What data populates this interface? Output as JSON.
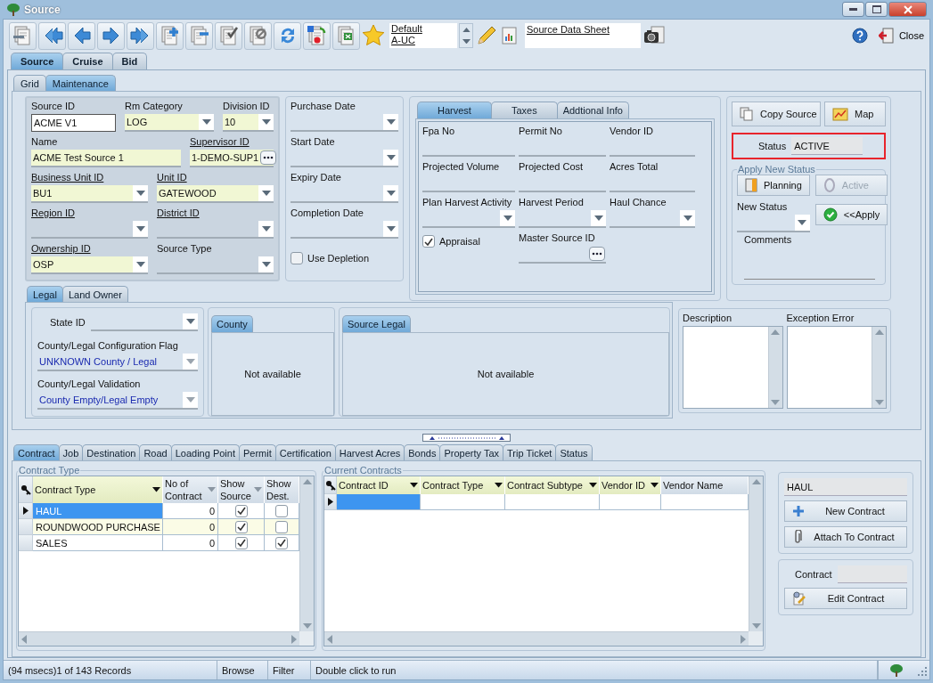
{
  "window": {
    "title": "Source",
    "close_label": "Close"
  },
  "toolbar": {
    "layouts": [
      "Default",
      "A-UC"
    ],
    "report": "Source Data Sheet"
  },
  "main_tabs": [
    {
      "label": "Source",
      "selected": true
    },
    {
      "label": "Cruise",
      "selected": false
    },
    {
      "label": "Bid",
      "selected": false
    }
  ],
  "sub_tabs": [
    {
      "label": "Grid",
      "selected": false
    },
    {
      "label": "Maintenance",
      "selected": true
    }
  ],
  "source": {
    "rows": [
      [
        {
          "label": "Source ID",
          "value": "ACME V1",
          "kind": "text",
          "link": false,
          "required": false,
          "focused": true
        },
        {
          "label": "Rm Category",
          "value": "LOG",
          "kind": "combo",
          "link": false,
          "required": true,
          "focused": false
        },
        {
          "label": "Division ID",
          "value": "10",
          "kind": "combo",
          "link": false,
          "required": true,
          "focused": false
        }
      ],
      [
        {
          "label": "Name",
          "value": "ACME Test Source 1",
          "kind": "text",
          "link": false,
          "required": true,
          "focused": false
        },
        {
          "label": "Supervisor ID",
          "value": "1-DEMO-SUP1",
          "kind": "lookup",
          "link": true,
          "required": true,
          "focused": false
        }
      ],
      [
        {
          "label": "Business Unit ID",
          "value": "BU1",
          "kind": "combo",
          "link": true,
          "required": true,
          "focused": false
        },
        {
          "label": "Unit ID",
          "value": "GATEWOOD",
          "kind": "combo",
          "link": true,
          "required": true,
          "focused": false
        }
      ],
      [
        {
          "label": "Region ID",
          "kind": "combo",
          "link": true,
          "required": false,
          "focused": false
        },
        {
          "label": "District ID",
          "kind": "combo",
          "link": true,
          "required": false,
          "focused": false
        }
      ],
      [
        {
          "label": "Ownership ID",
          "value": "OSP",
          "kind": "combo",
          "link": true,
          "required": true,
          "focused": false
        },
        {
          "label": "Source Type",
          "kind": "combo",
          "link": false,
          "required": false,
          "focused": false
        }
      ]
    ]
  },
  "dates": {
    "fields": [
      "Purchase Date",
      "Start Date",
      "Expiry Date",
      "Completion Date"
    ],
    "use_depletion": {
      "label": "Use Depletion",
      "checked": false
    }
  },
  "harvest": {
    "tabs": [
      {
        "label": "Harvest",
        "selected": true
      },
      {
        "label": "Taxes",
        "selected": false
      },
      {
        "label": "Addtional Info",
        "selected": false
      }
    ],
    "rows": [
      [
        {
          "label": "Fpa No",
          "kind": "text"
        },
        {
          "label": "Permit No",
          "kind": "text"
        },
        {
          "label": "Vendor ID",
          "kind": "text"
        }
      ],
      [
        {
          "label": "Projected Volume",
          "kind": "text"
        },
        {
          "label": "Projected Cost",
          "kind": "text"
        },
        {
          "label": "Acres Total",
          "kind": "text"
        }
      ],
      [
        {
          "label": "Plan Harvest Activity",
          "kind": "combo"
        },
        {
          "label": "Harvest Period",
          "kind": "combo"
        },
        {
          "label": "Haul Chance",
          "kind": "combo"
        }
      ],
      [
        {
          "label": "Appraisal",
          "kind": "checkbox",
          "checked": true
        },
        {
          "label": "Master Source ID",
          "kind": "lookup"
        }
      ]
    ]
  },
  "actions": {
    "buttons": [
      "Copy Source",
      "Map"
    ],
    "status": {
      "label": "Status",
      "value": "ACTIVE"
    },
    "apply": {
      "title": "Apply New Status",
      "buttons": [
        {
          "label": "Planning",
          "disabled": false
        },
        {
          "label": "Active",
          "disabled": true
        }
      ],
      "new_status_label": "New Status",
      "apply_button": "<<Apply",
      "comments_label": "Comments"
    }
  },
  "legal": {
    "tabs": [
      {
        "label": "Legal",
        "selected": true
      },
      {
        "label": "Land Owner",
        "selected": false
      }
    ],
    "state_label": "State ID",
    "fields": [
      {
        "label": "County/Legal Configuration Flag",
        "value": "UNKNOWN County / Legal"
      },
      {
        "label": "County/Legal Validation",
        "value": "County Empty/Legal Empty"
      }
    ],
    "panels": [
      {
        "tab": "County",
        "message": "Not available"
      },
      {
        "tab": "Source Legal",
        "message": "Not available"
      }
    ]
  },
  "notes": [
    "Description",
    "Exception Error"
  ],
  "bottom_tabs": [
    {
      "label": "Contract",
      "selected": true
    },
    {
      "label": "Job",
      "selected": false
    },
    {
      "label": "Destination",
      "selected": false
    },
    {
      "label": "Road",
      "selected": false
    },
    {
      "label": "Loading Point",
      "selected": false
    },
    {
      "label": "Permit",
      "selected": false
    },
    {
      "label": "Certification",
      "selected": false
    },
    {
      "label": "Harvest Acres",
      "selected": false
    },
    {
      "label": "Bonds",
      "selected": false
    },
    {
      "label": "Property Tax",
      "selected": false
    },
    {
      "label": "Trip Ticket",
      "selected": false
    },
    {
      "label": "Status",
      "selected": false
    }
  ],
  "contract_types": {
    "title": "Contract Type",
    "columns": [
      {
        "label": "Contract Type",
        "highlighted": true
      },
      {
        "label": "No of Contract",
        "highlighted": false
      },
      {
        "label": "Show Source",
        "highlighted": false
      },
      {
        "label": "Show Dest.",
        "highlighted": false
      }
    ],
    "rows": [
      {
        "type": "HAUL",
        "count": "0",
        "show_source": true,
        "show_dest": false,
        "selected": true
      },
      {
        "type": "ROUNDWOOD PURCHASE",
        "count": "0",
        "show_source": true,
        "show_dest": false,
        "selected": false
      },
      {
        "type": "SALES",
        "count": "0",
        "show_source": true,
        "show_dest": true,
        "selected": false
      }
    ]
  },
  "current_contracts": {
    "title": "Current Contracts",
    "columns": [
      {
        "label": "Contract ID",
        "filter": true
      },
      {
        "label": "Contract Type",
        "filter": true
      },
      {
        "label": "Contract Subtype",
        "filter": true
      },
      {
        "label": "Vendor ID",
        "filter": true
      },
      {
        "label": "Vendor Name",
        "filter": false
      }
    ],
    "rows": [
      {
        "selected": true
      }
    ]
  },
  "haul_panel": {
    "value": "HAUL",
    "buttons": [
      "New Contract",
      "Attach To Contract"
    ]
  },
  "contract_panel": {
    "label": "Contract",
    "button": "Edit Contract"
  },
  "status_bar": [
    "(94 msecs)1 of 143 Records",
    "Browse",
    "Filter",
    "Double click to run"
  ]
}
